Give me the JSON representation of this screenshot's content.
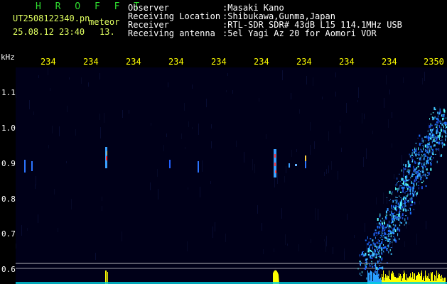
{
  "app": {
    "title": "H R O F F T",
    "file": "UT2508122340.pn",
    "mode": "meteor",
    "datetime": "25.08.12 23:40",
    "counter": "13.",
    "kHz_label": "kHz"
  },
  "info": {
    "observer_label": "Observer",
    "observer_value": ":Masaki Kano",
    "location_label": "Receiving Location",
    "location_value": ":Shibukawa,Gunma,Japan",
    "receiver_label": "Receiver",
    "receiver_value": ":RTL-SDR SDR# 43dB L15 114.1MHz USB",
    "antenna_label": "Receiving antenna",
    "antenna_value": ":5el Yagi Az 20 for Aomori VOR"
  },
  "time_axis": [
    "234",
    "234",
    "234",
    "234",
    "234",
    "234",
    "234",
    "234",
    "234",
    "2350"
  ],
  "freq_axis": [
    "1.1",
    "1.0",
    "0.9",
    "0.8",
    "0.7",
    "0.6"
  ],
  "colors": {
    "background": "#000000",
    "text_header": "#ffffff",
    "title_green": "#2fdc2f",
    "time_yellow": "#ffff00",
    "signal_blue": "#1a6cff",
    "signal_cyan": "#5ff"
  }
}
